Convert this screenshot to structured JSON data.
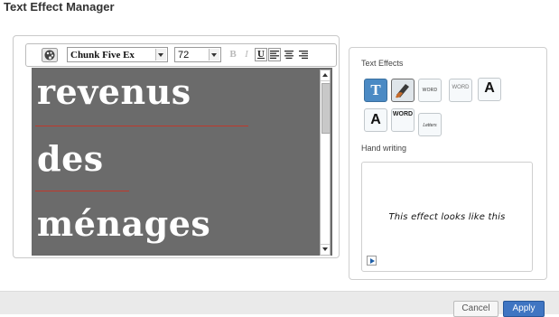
{
  "window": {
    "title": "Text Effect Manager"
  },
  "toolbar": {
    "palette_icon": "palette-icon",
    "font_family": "Chunk Five Ex",
    "font_size": "72",
    "format_buttons": {
      "bold": "B",
      "italic": "I",
      "underline": "U",
      "align_left": "align-left-icon",
      "align_center": "align-center-icon",
      "align_right": "align-right-icon"
    }
  },
  "canvas": {
    "background": "#6b6b6b",
    "lines": [
      "revenus",
      "des",
      "ménages"
    ]
  },
  "effects": {
    "section_label": "Text Effects",
    "tiles": [
      {
        "id": "effect-plain-t",
        "text": "T"
      },
      {
        "id": "effect-brush",
        "text": ""
      },
      {
        "id": "effect-word-small",
        "text": "WORD"
      },
      {
        "id": "effect-word-outline",
        "text": "WORD"
      },
      {
        "id": "effect-a-bold",
        "text": "A"
      },
      {
        "id": "effect-a-shadow",
        "text": "A"
      },
      {
        "id": "effect-word-tall",
        "text": "WORD"
      },
      {
        "id": "effect-letters",
        "text": "Letters"
      }
    ],
    "selected_index": 1
  },
  "handwriting": {
    "label": "Hand writing",
    "preview_text": "This effect looks like this"
  },
  "footer": {
    "cancel_label": "Cancel",
    "apply_label": "Apply"
  },
  "colors": {
    "accent": "#3f75c2",
    "underline": "#c0392b"
  }
}
